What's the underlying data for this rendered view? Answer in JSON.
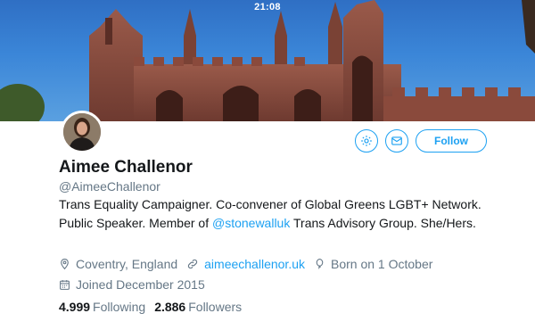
{
  "status_bar": {
    "time": "21:08"
  },
  "actions": {
    "follow_label": "Follow"
  },
  "profile": {
    "name": "Aimee Challenor",
    "handle": "@AimeeChallenor",
    "bio": {
      "part1": "Trans Equality Campaigner. Co-convener of Global Greens LGBT+ Network. Public Speaker. Member of ",
      "mention": "@stonewalluk",
      "part2": " Trans Advisory Group. She/Hers."
    },
    "location": "Coventry, England",
    "website": "aimeechallenor.uk",
    "birthday": "Born on 1 October",
    "joined": "Joined December 2015"
  },
  "stats": {
    "following_count": "4.999",
    "following_label": "Following",
    "followers_count": "2.886",
    "followers_label": "Followers"
  },
  "colors": {
    "accent": "#1da1f2",
    "muted": "#657786",
    "text": "#14171a"
  },
  "icons": [
    "gear-icon",
    "mail-icon",
    "location-pin-icon",
    "link-icon",
    "balloon-icon",
    "calendar-icon"
  ]
}
